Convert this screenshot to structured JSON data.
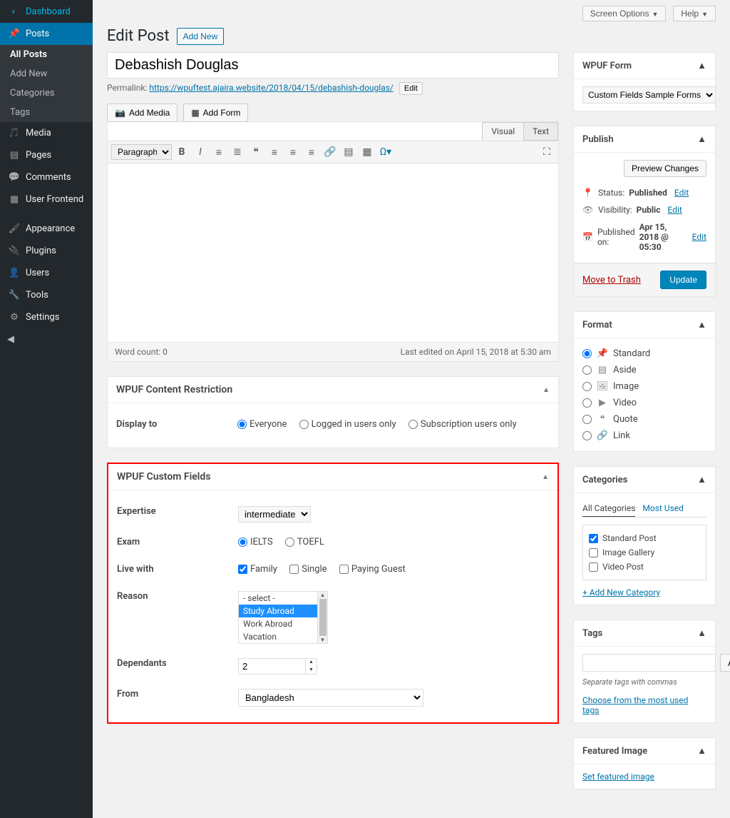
{
  "topbar": {
    "screen_options": "Screen Options",
    "help": "Help"
  },
  "sidebar": {
    "dashboard": "Dashboard",
    "posts": "Posts",
    "posts_sub": {
      "all": "All Posts",
      "add": "Add New",
      "cat": "Categories",
      "tags": "Tags"
    },
    "media": "Media",
    "pages": "Pages",
    "comments": "Comments",
    "user_frontend": "User Frontend",
    "appearance": "Appearance",
    "plugins": "Plugins",
    "users": "Users",
    "tools": "Tools",
    "settings": "Settings",
    "collapse": "Collapse menu"
  },
  "header": {
    "title": "Edit Post",
    "add_new": "Add New"
  },
  "post": {
    "title": "Debashish Douglas",
    "permalink_label": "Permalink:",
    "permalink_url": "https://wpuftest.ajaira.website/2018/04/15/debashish-douglas/",
    "permalink_edit": "Edit",
    "add_media": "Add Media",
    "add_form": "Add Form",
    "tab_visual": "Visual",
    "tab_text": "Text",
    "format_sel": "Paragraph",
    "wordcount": "Word count: 0",
    "lastedit": "Last edited on April 15, 2018 at 5:30 am"
  },
  "restriction": {
    "title": "WPUF Content Restriction",
    "display_to": "Display to",
    "everyone": "Everyone",
    "logged": "Logged in users only",
    "sub": "Subscription users only"
  },
  "custom": {
    "title": "WPUF Custom Fields",
    "expertise_label": "Expertise",
    "expertise_val": "intermediate",
    "exam_label": "Exam",
    "exam_ielts": "IELTS",
    "exam_toefl": "TOEFL",
    "live_label": "Live with",
    "live_family": "Family",
    "live_single": "Single",
    "live_guest": "Paying Guest",
    "reason_label": "Reason",
    "reason_opts": {
      "sel": "- select -",
      "o1": "Study Abroad",
      "o2": "Work Abroad",
      "o3": "Vacation"
    },
    "dep_label": "Dependants",
    "dep_val": "2",
    "from_label": "From",
    "from_val": "Bangladesh"
  },
  "wpuf_form": {
    "title": "WPUF Form",
    "selected": "Custom Fields Sample Forms"
  },
  "publish": {
    "title": "Publish",
    "preview": "Preview Changes",
    "status_label": "Status:",
    "status_val": "Published",
    "edit": "Edit",
    "vis_label": "Visibility:",
    "vis_val": "Public",
    "pub_label": "Published on:",
    "pub_val": "Apr 15, 2018 @ 05:30",
    "trash": "Move to Trash",
    "update": "Update"
  },
  "format": {
    "title": "Format",
    "standard": "Standard",
    "aside": "Aside",
    "image": "Image",
    "video": "Video",
    "quote": "Quote",
    "link": "Link"
  },
  "categories": {
    "title": "Categories",
    "tab_all": "All Categories",
    "tab_used": "Most Used",
    "c1": "Standard Post",
    "c2": "Image Gallery",
    "c3": "Video Post",
    "add_new": "+ Add New Category"
  },
  "tags": {
    "title": "Tags",
    "add": "Add",
    "hint": "Separate tags with commas",
    "choose": "Choose from the most used tags"
  },
  "featured": {
    "title": "Featured Image",
    "link": "Set featured image"
  }
}
